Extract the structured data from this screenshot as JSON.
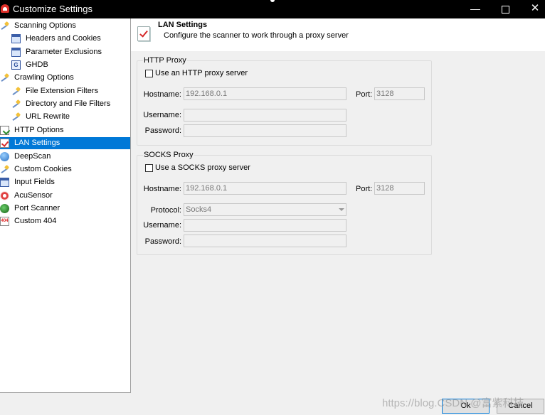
{
  "window": {
    "title": "Customize Settings",
    "minimize": "—",
    "close": "✕"
  },
  "tree": [
    {
      "label": "Scanning Options",
      "icon": "wand-icon",
      "indent": 0,
      "selected": false
    },
    {
      "label": "Headers and Cookies",
      "icon": "window-icon",
      "indent": 1,
      "selected": false
    },
    {
      "label": "Parameter Exclusions",
      "icon": "window-icon",
      "indent": 1,
      "selected": false
    },
    {
      "label": "GHDB",
      "icon": "ghdb-icon",
      "indent": 1,
      "selected": false
    },
    {
      "label": "Crawling Options",
      "icon": "wand-icon",
      "indent": 0,
      "selected": false
    },
    {
      "label": "File Extension Filters",
      "icon": "wand-icon",
      "indent": 1,
      "selected": false
    },
    {
      "label": "Directory and File Filters",
      "icon": "wand-icon",
      "indent": 1,
      "selected": false
    },
    {
      "label": "URL Rewrite",
      "icon": "wand-icon",
      "indent": 1,
      "selected": false
    },
    {
      "label": "HTTP Options",
      "icon": "page-icon",
      "indent": 0,
      "selected": false
    },
    {
      "label": "LAN Settings",
      "icon": "check-icon",
      "indent": 0,
      "selected": true
    },
    {
      "label": "DeepScan",
      "icon": "globe-icon",
      "indent": 0,
      "selected": false
    },
    {
      "label": "Custom Cookies",
      "icon": "wand-icon",
      "indent": 0,
      "selected": false
    },
    {
      "label": "Input Fields",
      "icon": "window-icon",
      "indent": 0,
      "selected": false
    },
    {
      "label": "AcuSensor",
      "icon": "sensor-icon",
      "indent": 0,
      "selected": false
    },
    {
      "label": "Port Scanner",
      "icon": "scanner-icon",
      "indent": 0,
      "selected": false
    },
    {
      "label": "Custom 404",
      "icon": "404-icon",
      "indent": 0,
      "selected": false
    }
  ],
  "header": {
    "title": "LAN Settings",
    "description": "Configure the scanner to work through a proxy server"
  },
  "http_proxy": {
    "legend": "HTTP Proxy",
    "checkbox_label": "Use an HTTP proxy server",
    "checked": false,
    "hostname_label": "Hostname:",
    "hostname_value": "192.168.0.1",
    "port_label": "Port:",
    "port_value": "3128",
    "username_label": "Username:",
    "username_value": "",
    "password_label": "Password:",
    "password_value": ""
  },
  "socks_proxy": {
    "legend": "SOCKS Proxy",
    "checkbox_label": "Use a SOCKS proxy server",
    "checked": false,
    "hostname_label": "Hostname:",
    "hostname_value": "192.168.0.1",
    "port_label": "Port:",
    "port_value": "3128",
    "protocol_label": "Protocol:",
    "protocol_value": "Socks4",
    "username_label": "Username:",
    "username_value": "",
    "password_label": "Password:",
    "password_value": ""
  },
  "buttons": {
    "ok": "Ok",
    "cancel": "Cancel"
  },
  "watermark": "https://blog.CSDN @富紫科技"
}
